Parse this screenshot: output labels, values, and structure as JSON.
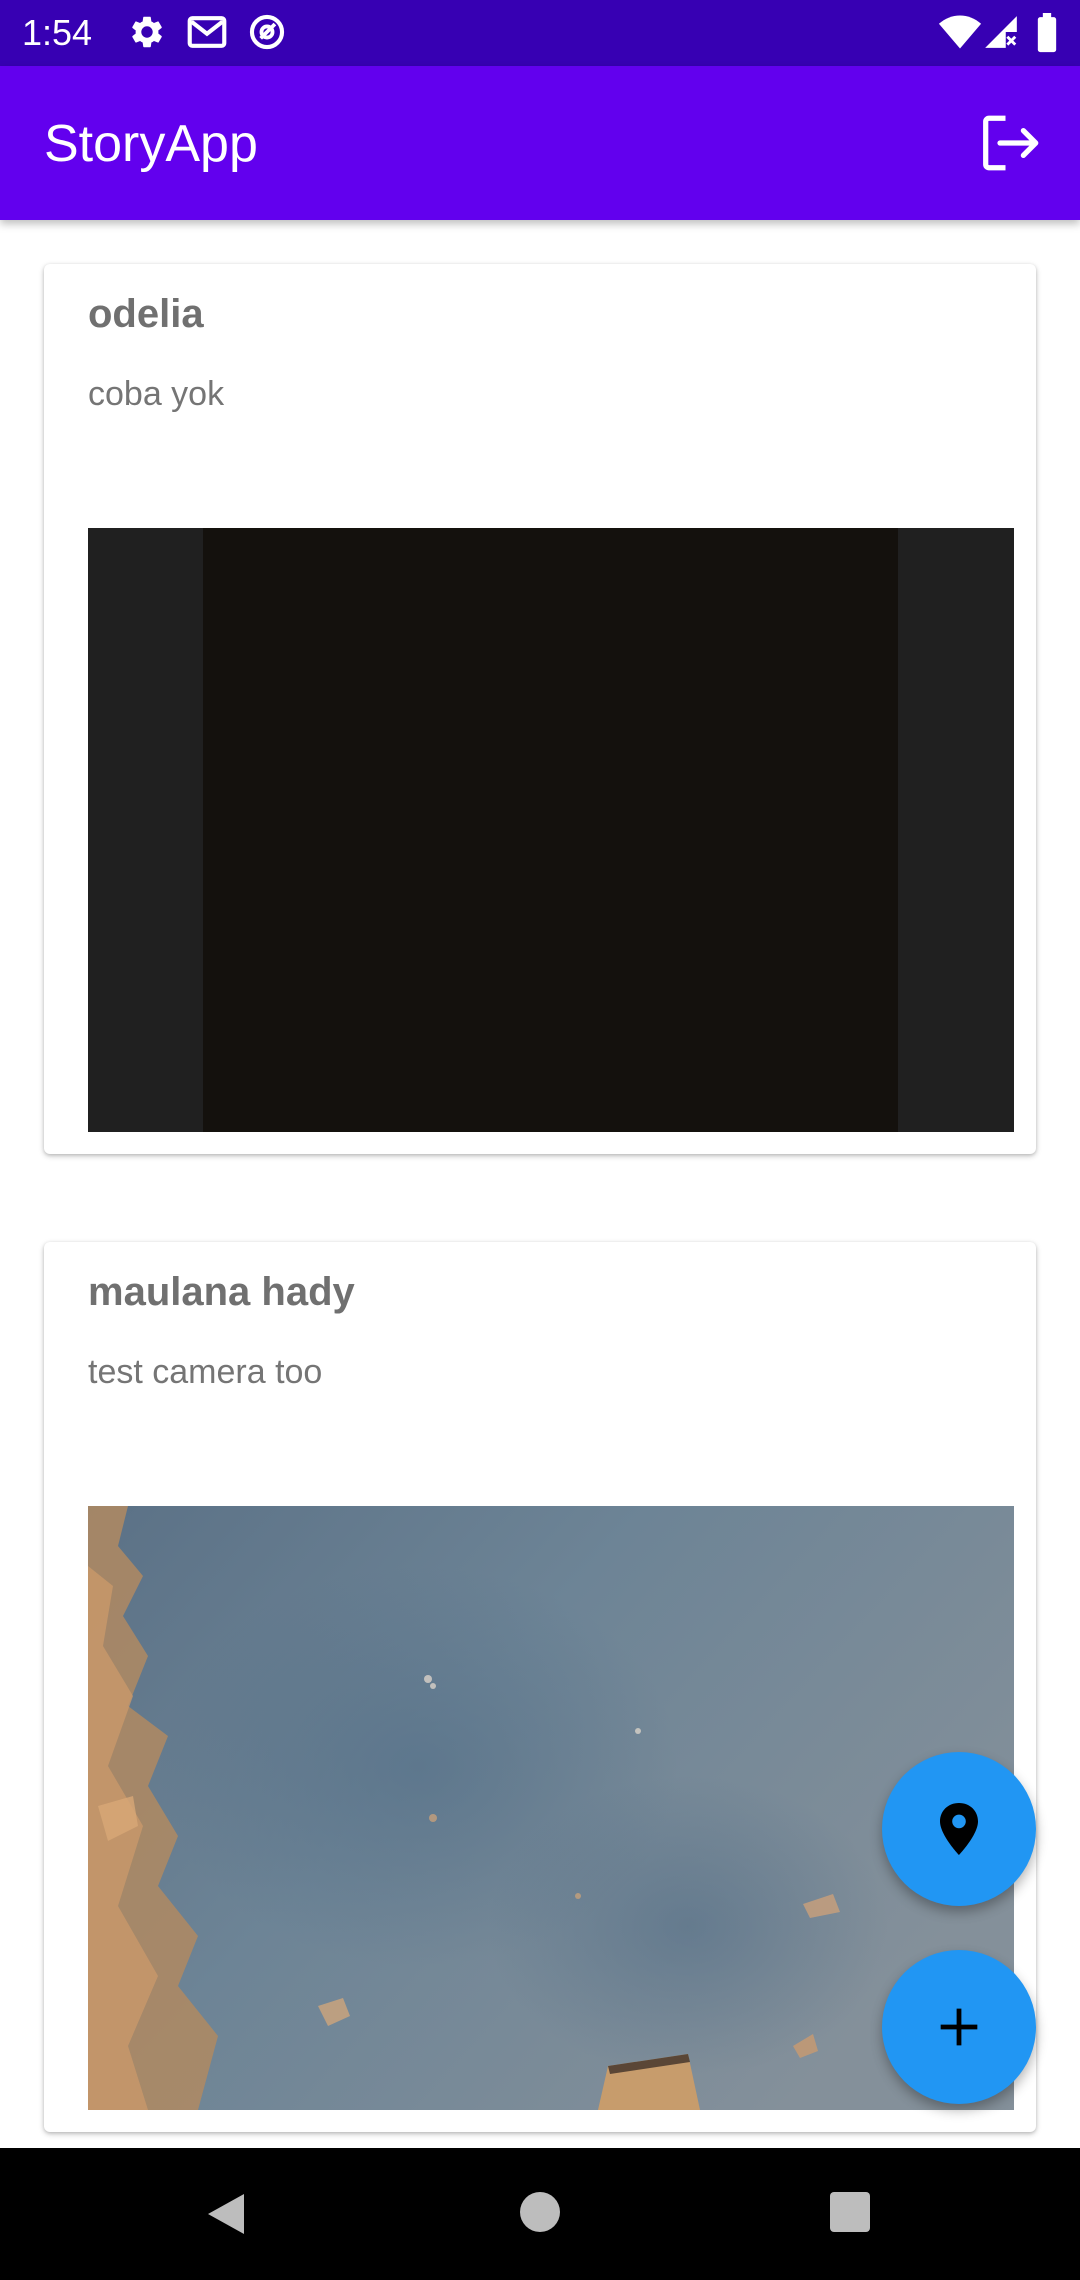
{
  "status_bar": {
    "time": "1:54",
    "left_icons": [
      "gear-icon",
      "gmail-icon",
      "at-sign-icon"
    ],
    "right_icons": [
      "wifi-icon",
      "signal-icon",
      "battery-icon"
    ]
  },
  "app_bar": {
    "title": "StoryApp",
    "logout_icon": "logout-icon"
  },
  "stories": [
    {
      "name": "odelia",
      "description": "coba yok"
    },
    {
      "name": "maulana hady",
      "description": "test camera too"
    }
  ],
  "fabs": {
    "map_icon": "location-pin-icon",
    "add_icon": "plus-icon",
    "color": "#2196f3"
  },
  "navigation": {
    "back_icon": "back-triangle-icon",
    "home_icon": "home-circle-icon",
    "recents_icon": "recents-square-icon"
  },
  "colors": {
    "status_bar": "#3700b3",
    "app_bar": "#6200ee"
  }
}
